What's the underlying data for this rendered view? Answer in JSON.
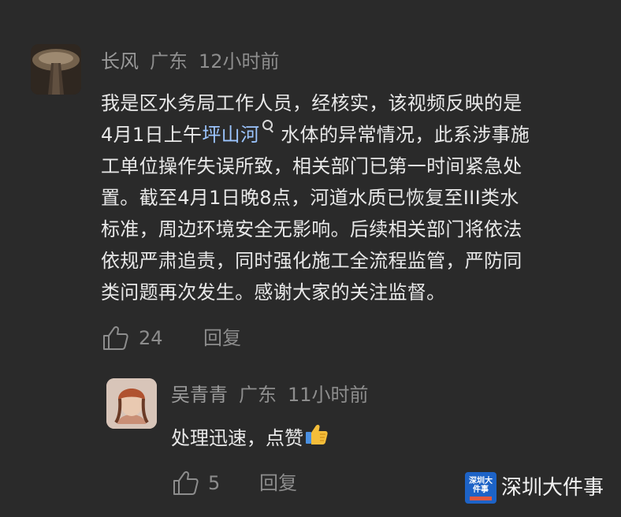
{
  "comment": {
    "user": "长风",
    "location": "广东",
    "time": "12小时前",
    "lines": [
      "我是区水务局工作人员，经核实，该视频反映的是",
      "4月1日上午",
      "水体的异常情况，此系涉事施",
      "工单位操作失误所致，相关部门已第一时间紧急处",
      "置。截至4月1日晚8点，河道水质已恢复至III类水",
      "标准，周边环境安全无影响。后续相关部门将依法",
      "依规严肃追责，同时强化施工全流程监管，严防同",
      "类问题再次发生。感谢大家的关注监督。"
    ],
    "link_text": "坪山河",
    "like_count": "24",
    "reply_label": "回复"
  },
  "reply": {
    "user": "吴青青",
    "location": "广东",
    "time": "11小时前",
    "text": "处理迅速，点赞",
    "like_count": "5",
    "reply_label": "回复"
  },
  "watermark": {
    "text": "深圳大件事",
    "logo_text": "深圳大件事"
  },
  "icons": {
    "like": "thumbs-up-outline-icon",
    "search": "search-icon",
    "emoji": "thumbs-up-emoji"
  },
  "colors": {
    "background": "#2a2a2a",
    "text": "#e8e8e8",
    "meta": "#8d8d8d",
    "link": "#9cc5ff",
    "logo_blue": "#1d63c7"
  }
}
